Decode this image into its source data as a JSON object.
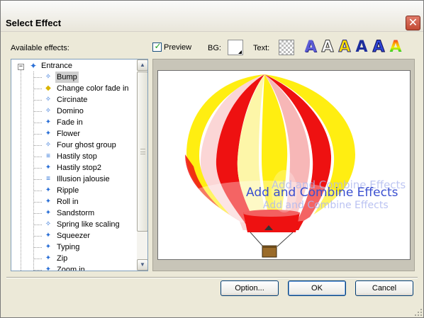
{
  "window": {
    "title": "Select Effect",
    "close_glyph": "✕"
  },
  "labels": {
    "available_effects": "Available effects:",
    "preview": "Preview",
    "bg": "BG:",
    "text": "Text:"
  },
  "preview_checked": true,
  "text_style_buttons": [
    {
      "glyph": "A",
      "style": "blue-shadow"
    },
    {
      "glyph": "A",
      "style": "outline"
    },
    {
      "glyph": "A",
      "style": "yellow-outline"
    },
    {
      "glyph": "A",
      "style": "blue-bold"
    },
    {
      "glyph": "A",
      "style": "blue-outline"
    },
    {
      "glyph": "A",
      "style": "rainbow"
    }
  ],
  "tree": {
    "root": {
      "label": "Entrance",
      "expand_glyph": "−"
    },
    "selected": "Bump",
    "items": [
      {
        "label": "Bump",
        "icon": "dotted-star-icon"
      },
      {
        "label": "Change color fade in",
        "icon": "color-fade-icon"
      },
      {
        "label": "Circinate",
        "icon": "dotted-star-icon"
      },
      {
        "label": "Domino",
        "icon": "dotted-star-icon"
      },
      {
        "label": "Fade in",
        "icon": "fade-star-icon"
      },
      {
        "label": "Flower",
        "icon": "fade-star-icon"
      },
      {
        "label": "Four ghost group",
        "icon": "dotted-star-icon"
      },
      {
        "label": "Hastily stop",
        "icon": "lines-star-icon"
      },
      {
        "label": "Hastily stop2",
        "icon": "fade-star-icon"
      },
      {
        "label": "Illusion jalousie",
        "icon": "lines-star-icon"
      },
      {
        "label": "Ripple",
        "icon": "fade-star-icon"
      },
      {
        "label": "Roll in",
        "icon": "fade-star-icon"
      },
      {
        "label": "Sandstorm",
        "icon": "fade-star-icon"
      },
      {
        "label": "Spring like scaling",
        "icon": "dotted-star-icon"
      },
      {
        "label": "Squeezer",
        "icon": "fade-star-icon"
      },
      {
        "label": "Typing",
        "icon": "fade-star-icon"
      },
      {
        "label": "Zip",
        "icon": "fade-star-icon"
      },
      {
        "label": "Zoom in",
        "icon": "fade-star-icon"
      }
    ]
  },
  "preview_pane": {
    "effect_text": "Add and Combine Effects",
    "ghost_text_upper": "Add and Combine Effects",
    "ghost_text_lower": "Add and Combine Effects"
  },
  "buttons": {
    "option": "Option...",
    "ok": "OK",
    "cancel": "Cancel"
  },
  "colors": {
    "balloon_red": "#ee1111",
    "balloon_yellow": "#ffee11",
    "effect_text": "#3a4fd0",
    "tree_icon": "#2a6fd6"
  }
}
